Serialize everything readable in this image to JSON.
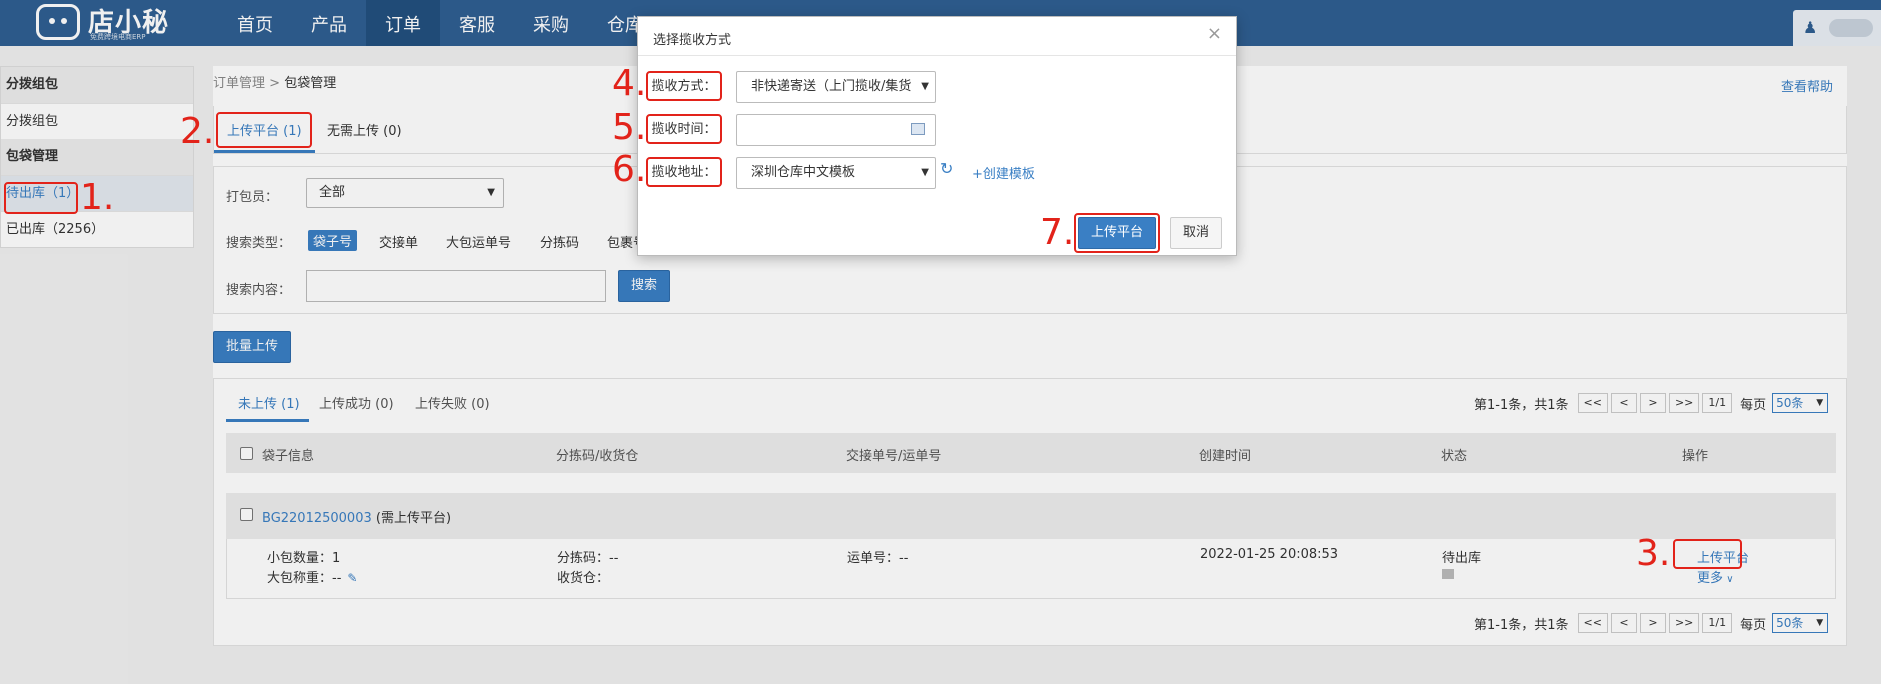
{
  "app": {
    "logo_text": "店小秘",
    "logo_subtitle": "免费跨境电商ERP",
    "nav": [
      "首页",
      "产品",
      "订单",
      "客服",
      "采购",
      "仓库"
    ],
    "nav_active_index": 2
  },
  "sidebar": {
    "groups": [
      {
        "title": "分拨组包",
        "items": [
          {
            "label": "分拨组包"
          }
        ]
      },
      {
        "title": "包袋管理",
        "items": [
          {
            "label": "待出库（1）"
          },
          {
            "label": "已出库（2256）"
          }
        ]
      }
    ]
  },
  "breadcrumb": {
    "parent": "订单管理",
    "sep": ">",
    "current": "包袋管理"
  },
  "help_link": "查看帮助",
  "top_tabs": [
    "上传平台 (1)",
    "无需上传 (0)"
  ],
  "filter": {
    "packer_label": "打包员：",
    "packer_value": "全部",
    "search_type_label": "搜索类型：",
    "search_types": [
      "袋子号",
      "交接单",
      "大包运单号",
      "分拣码",
      "包裹号"
    ],
    "search_content_label": "搜索内容：",
    "search_value": "",
    "search_button": "搜索"
  },
  "batch_upload_button": "批量上传",
  "result_tabs": [
    "未上传 (1)",
    "上传成功 (0)",
    "上传失败 (0)"
  ],
  "pager": {
    "summary": "第1-1条，共1条",
    "first": "<<",
    "prev": "<",
    "next": ">",
    "last": ">>",
    "page": "1/1",
    "per_page_label": "每页",
    "per_page_value": "50条"
  },
  "table": {
    "columns": [
      "袋子信息",
      "分拣码/收货仓",
      "交接单号/运单号",
      "创建时间",
      "状态",
      "操作"
    ],
    "rows": [
      {
        "bag_no": "BG22012500003",
        "bag_note": "(需上传平台)",
        "small_pkg_label": "小包数量：",
        "small_pkg_value": "1",
        "weight_label": "大包称重：",
        "weight_value": "--",
        "sort_code_label": "分拣码：",
        "sort_code_value": "--",
        "warehouse_label": "收货仓：",
        "warehouse_value": "",
        "tracking_label": "运单号：",
        "tracking_value": "--",
        "created": "2022-01-25 20:08:53",
        "status": "待出库",
        "action": "上传平台",
        "more": "更多"
      }
    ]
  },
  "modal": {
    "title": "选择揽收方式",
    "close": "×",
    "method_label": "揽收方式：",
    "method_value": "非快递寄送（上门揽收/集货",
    "time_label": "揽收时间：",
    "time_value": "",
    "address_label": "揽收地址：",
    "address_value": "深圳仓库中文模板",
    "create_template": "+创建模板",
    "submit": "上传平台",
    "cancel": "取消"
  },
  "annotations": [
    "1.",
    "2.",
    "3.",
    "4.",
    "5.",
    "6.",
    "7."
  ],
  "colors": {
    "nav_bg": "#2f5f92",
    "accent": "#3a7fc4",
    "annotation": "#e2231a"
  }
}
